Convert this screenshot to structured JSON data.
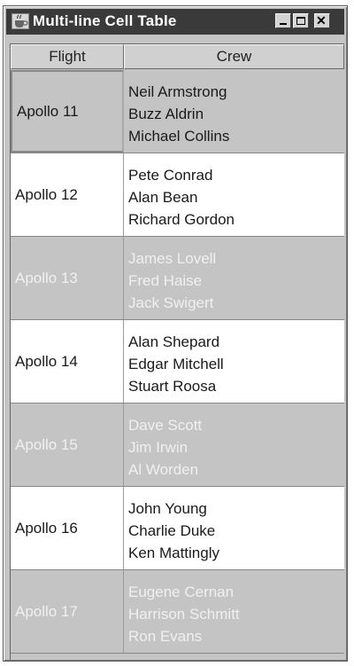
{
  "window": {
    "title": "Multi-line Cell Table",
    "icon": "java-cup-icon",
    "controls": {
      "minimize": "minimize-icon",
      "maximize": "maximize-icon",
      "close": "close-icon"
    }
  },
  "table": {
    "headers": {
      "flight": "Flight",
      "crew": "Crew"
    },
    "rows": [
      {
        "flight": "Apollo 11",
        "crew": [
          "Neil Armstrong",
          "Buzz Aldrin",
          "Michael Collins"
        ]
      },
      {
        "flight": "Apollo 12",
        "crew": [
          "Pete Conrad",
          "Alan Bean",
          "Richard Gordon"
        ]
      },
      {
        "flight": "Apollo 13",
        "crew": [
          "James Lovell",
          "Fred Haise",
          "Jack Swigert"
        ]
      },
      {
        "flight": "Apollo 14",
        "crew": [
          "Alan Shepard",
          "Edgar Mitchell",
          "Stuart Roosa"
        ]
      },
      {
        "flight": "Apollo 15",
        "crew": [
          "Dave Scott",
          "Jim Irwin",
          "Al Worden"
        ]
      },
      {
        "flight": "Apollo 16",
        "crew": [
          "John Young",
          "Charlie Duke",
          "Ken Mattingly"
        ]
      },
      {
        "flight": "Apollo 17",
        "crew": [
          "Eugene Cernan",
          "Harrison Schmitt",
          "Ron Evans"
        ]
      }
    ]
  },
  "colors": {
    "titlebar": "#3a3a3a",
    "row_gray": "#c4c4c4",
    "row_white": "#ffffff",
    "text_on_gray": "#f0f0f0",
    "text_dark": "#1a1a1a"
  }
}
